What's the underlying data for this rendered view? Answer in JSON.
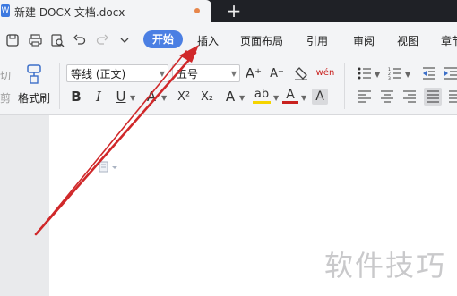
{
  "title_bar": {
    "doc_icon": "wps-writer-icon",
    "doc_icon_glyph": "W",
    "doc_title": "新建 DOCX 文档.docx",
    "new_tab": "+"
  },
  "quick_access": {
    "save": "save-icon",
    "print": "print-icon",
    "preview": "print-preview-icon",
    "undo": "undo-icon",
    "redo": "redo-icon",
    "more": "more-icon"
  },
  "menu": {
    "start": "开始",
    "items": [
      "插入",
      "页面布局",
      "引用",
      "审阅",
      "视图",
      "章节"
    ]
  },
  "ribbon": {
    "cut_label": "切",
    "cut_sub": "剪",
    "format_painter_label": "格式刷",
    "font_name": "等线 (正文)",
    "font_size": "五号",
    "buttons": {
      "grow_font": "A⁺",
      "shrink_font": "A⁻",
      "clear_format": "◇",
      "pinyin": "wén",
      "bold": "B",
      "italic": "I",
      "underline": "U",
      "strikethrough": "A",
      "superscript": "X²",
      "subscript": "X₂",
      "text_effect": "A",
      "highlight": "ab",
      "font_color": "A",
      "char_shading": "A"
    },
    "colors": {
      "highlight": "#f5d400",
      "font_color": "#c9211e"
    }
  },
  "document": {
    "watermark": "软件技巧"
  },
  "annotation": {
    "arrow_color": "#d0282a"
  }
}
